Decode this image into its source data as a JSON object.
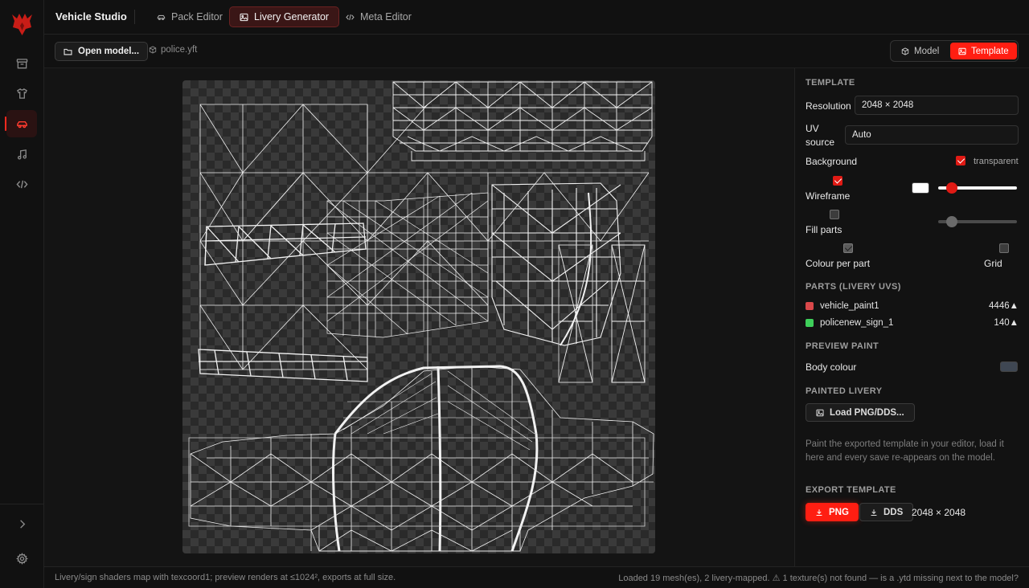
{
  "app": {
    "title": "Vehicle Studio"
  },
  "tabs": [
    {
      "label": "Pack Editor",
      "icon": "car-icon"
    },
    {
      "label": "Livery Generator",
      "icon": "image-icon",
      "active": true
    },
    {
      "label": "Meta Editor",
      "icon": "code-icon"
    }
  ],
  "rail": {
    "items": [
      "archive-icon",
      "shirt-icon",
      "car-icon",
      "music-icon",
      "code-icon"
    ],
    "active": "car-icon",
    "bottom": [
      "chevron-right-icon",
      "gear-icon"
    ]
  },
  "toolbar": {
    "open_label": "Open model...",
    "filename": "police.yft",
    "view_model": "Model",
    "view_template": "Template",
    "active_view": "Template"
  },
  "panel": {
    "template_heading": "TEMPLATE",
    "resolution_label": "Resolution",
    "resolution_value": "2048 × 2048",
    "uv_label": "UV source",
    "uv_value": "Auto",
    "background_label": "Background",
    "transparent_label": "transparent",
    "transparent_checked": true,
    "wireframe_label": "Wireframe",
    "wireframe_checked": true,
    "wireframe_color": "#ffffff",
    "wireframe_slider": 0.17,
    "fill_label": "Fill parts",
    "fill_checked": false,
    "fill_slider": 0.17,
    "colour_per_part_label": "Colour per part",
    "colour_per_part_checked": true,
    "grid_label": "Grid",
    "grid_checked": false,
    "parts_heading": "PARTS (LIVERY UVS)",
    "parts": [
      {
        "name": "vehicle_paint1",
        "count": "4446▲",
        "color": "#d9484a"
      },
      {
        "name": "policenew_sign_1",
        "count": "140▲",
        "color": "#3ecf5a"
      }
    ],
    "preview_heading": "PREVIEW PAINT",
    "body_colour_label": "Body colour",
    "body_colour_value": "#3f4753",
    "painted_heading": "PAINTED LIVERY",
    "load_label": "Load PNG/DDS...",
    "note": "Paint the exported template in your editor, load it here and every save re-appears on the model.",
    "export_heading": "EXPORT TEMPLATE",
    "png_label": "PNG",
    "dds_label": "DDS",
    "export_size": "2048 × 2048"
  },
  "status": {
    "left": "Livery/sign shaders map with texcoord1; preview renders at ≤1024², exports at full size.",
    "right": "Loaded 19 mesh(es), 2 livery-mapped. ⚠ 1 texture(s) not found — is a .ytd missing next to the model?"
  },
  "colors": {
    "accent": "#ff1e12",
    "background": "#111111",
    "panel": "#121212"
  }
}
